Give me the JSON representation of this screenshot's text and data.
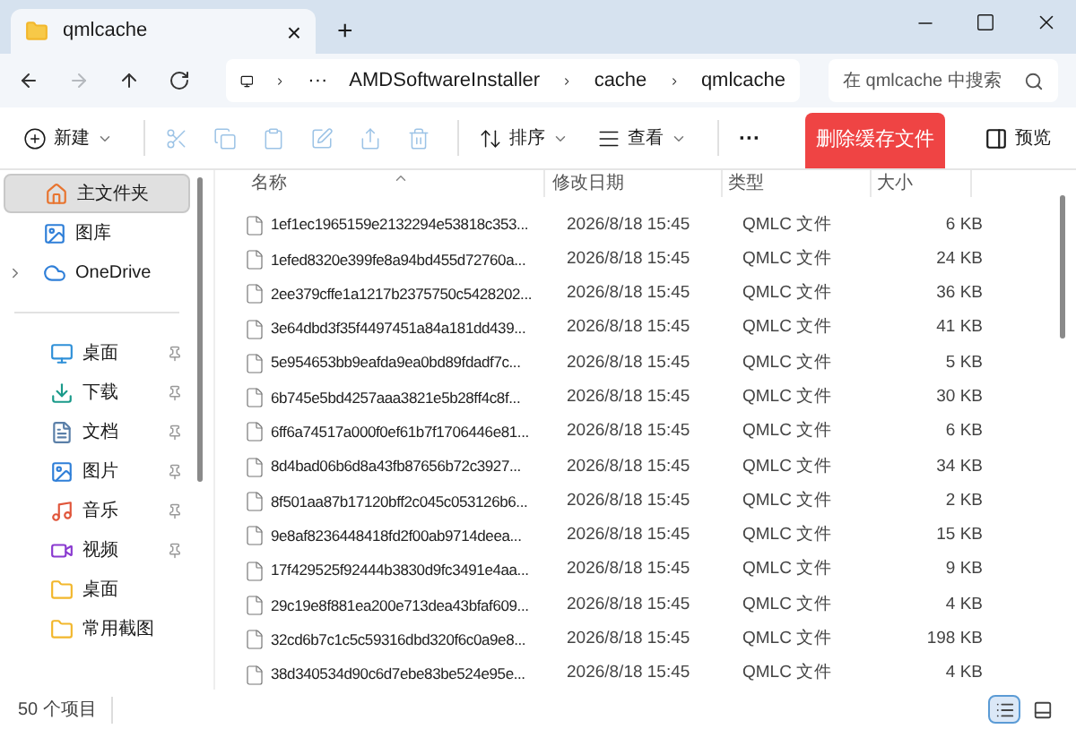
{
  "tab": {
    "title": "qmlcache",
    "close": "×",
    "new_tab": "+"
  },
  "nav": [
    {
      "kind": "back",
      "disabled": false
    },
    {
      "kind": "forward",
      "disabled": true
    },
    {
      "kind": "up",
      "disabled": false
    },
    {
      "kind": "refresh",
      "disabled": false
    }
  ],
  "breadcrumb": {
    "overflow": "···",
    "items": [
      "AMDSoftwareInstaller",
      "cache",
      "qmlcache"
    ]
  },
  "search": {
    "placeholder": "在 qmlcache 中搜索"
  },
  "toolbar": [
    {
      "kind": "new",
      "label": "新建",
      "disabled": false,
      "menu": true
    },
    {
      "kind": "cut",
      "disabled": true,
      "menu": false
    },
    {
      "kind": "copy",
      "disabled": true,
      "menu": false
    },
    {
      "kind": "paste",
      "disabled": true,
      "menu": false
    },
    {
      "kind": "rename",
      "disabled": true,
      "menu": false
    },
    {
      "kind": "share",
      "disabled": true,
      "menu": false
    },
    {
      "kind": "delete",
      "disabled": true,
      "menu": false
    },
    {
      "kind": "sort",
      "label": "排序",
      "disabled": false,
      "menu": true
    },
    {
      "kind": "view",
      "label": "查看",
      "disabled": false,
      "menu": true
    },
    {
      "kind": "more",
      "label": "···",
      "disabled": false,
      "menu": false
    }
  ],
  "banner_button": "删除缓存文件",
  "preview": "预览",
  "sidebar": [
    [
      {
        "kind": "home",
        "label": "主文件夹",
        "selected": true,
        "pinned": false,
        "expandable": false
      },
      {
        "kind": "gallery",
        "label": "图库",
        "selected": false,
        "pinned": false,
        "expandable": false
      },
      {
        "kind": "cloud",
        "label": "OneDrive",
        "selected": false,
        "pinned": false,
        "expandable": true
      }
    ],
    [
      {
        "kind": "desktop",
        "label": "桌面",
        "selected": false,
        "pinned": true,
        "expandable": false
      },
      {
        "kind": "download",
        "label": "下载",
        "selected": false,
        "pinned": true,
        "expandable": false
      },
      {
        "kind": "document",
        "label": "文档",
        "selected": false,
        "pinned": true,
        "expandable": false
      },
      {
        "kind": "picture",
        "label": "图片",
        "selected": false,
        "pinned": true,
        "expandable": false
      },
      {
        "kind": "music",
        "label": "音乐",
        "selected": false,
        "pinned": true,
        "expandable": false
      },
      {
        "kind": "video",
        "label": "视频",
        "selected": false,
        "pinned": true,
        "expandable": false
      },
      {
        "kind": "folder",
        "label": "桌面",
        "selected": false,
        "pinned": false,
        "expandable": false
      },
      {
        "kind": "folder",
        "label": "常用截图",
        "selected": false,
        "pinned": false,
        "expandable": false
      }
    ]
  ],
  "table": {
    "columns": [
      "名称",
      "修改日期",
      "类型",
      "大小"
    ],
    "rows": [
      [
        "1ef1ec1965159e2132294e53818c353...",
        "2026/8/18 15:45",
        "QMLC 文件",
        "6 KB"
      ],
      [
        "1efed8320e399fe8a94bd455d72760a...",
        "2026/8/18 15:45",
        "QMLC 文件",
        "24 KB"
      ],
      [
        "2ee379cffe1a1217b2375750c5428202...",
        "2026/8/18 15:45",
        "QMLC 文件",
        "36 KB"
      ],
      [
        "3e64dbd3f35f4497451a84a181dd439...",
        "2026/8/18 15:45",
        "QMLC 文件",
        "41 KB"
      ],
      [
        "5e954653bb9eafda9ea0bd89fdadf7c...",
        "2026/8/18 15:45",
        "QMLC 文件",
        "5 KB"
      ],
      [
        "6b745e5bd4257aaa3821e5b28ff4c8f...",
        "2026/8/18 15:45",
        "QMLC 文件",
        "30 KB"
      ],
      [
        "6ff6a74517a000f0ef61b7f1706446e81...",
        "2026/8/18 15:45",
        "QMLC 文件",
        "6 KB"
      ],
      [
        "8d4bad06b6d8a43fb87656b72c3927...",
        "2026/8/18 15:45",
        "QMLC 文件",
        "34 KB"
      ],
      [
        "8f501aa87b17120bff2c045c053126b6...",
        "2026/8/18 15:45",
        "QMLC 文件",
        "2 KB"
      ],
      [
        "9e8af8236448418fd2f00ab9714deea...",
        "2026/8/18 15:45",
        "QMLC 文件",
        "15 KB"
      ],
      [
        "17f429525f92444b3830d9fc3491e4aa...",
        "2026/8/18 15:45",
        "QMLC 文件",
        "9 KB"
      ],
      [
        "29c19e8f881ea200e713dea43bfaf609...",
        "2026/8/18 15:45",
        "QMLC 文件",
        "4 KB"
      ],
      [
        "32cd6b7c1c5c59316dbd320f6c0a9e8...",
        "2026/8/18 15:45",
        "QMLC 文件",
        "198 KB"
      ],
      [
        "38d340534d90c6d7ebe83be524e95e...",
        "2026/8/18 15:45",
        "QMLC 文件",
        "4 KB"
      ]
    ]
  },
  "status": {
    "count": "50 个项目",
    "views": [
      {
        "kind": "details",
        "selected": true
      },
      {
        "kind": "tiles",
        "selected": false
      }
    ]
  }
}
